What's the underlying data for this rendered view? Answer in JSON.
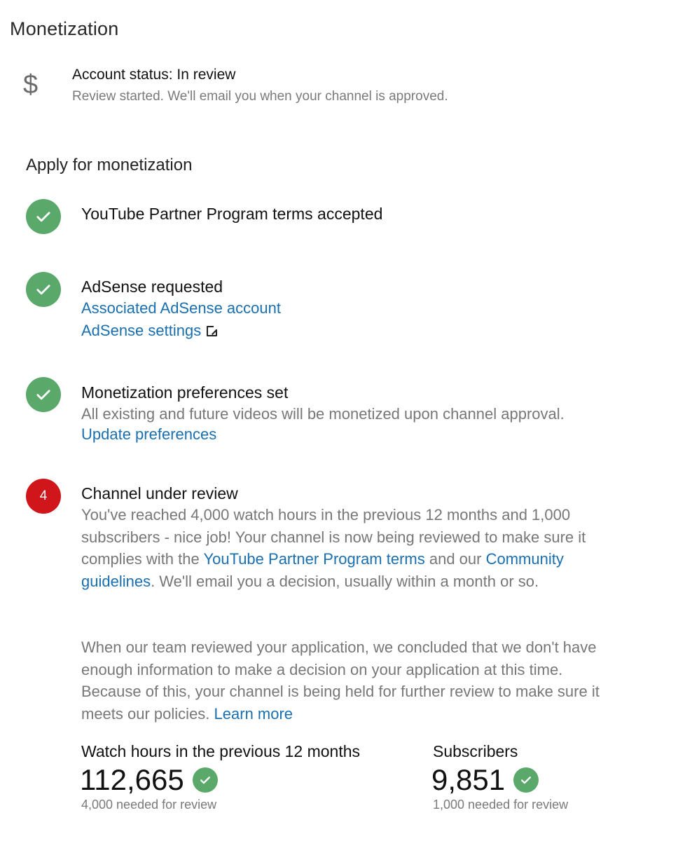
{
  "page": {
    "title": "Monetization"
  },
  "account": {
    "icon": "dollar-icon",
    "icon_glyph": "$",
    "status": "Account status: In review",
    "subtitle": "Review started. We'll email you when your channel is approved."
  },
  "apply": {
    "title": "Apply for monetization",
    "steps": [
      {
        "state": "done",
        "icon": "check-circle-icon",
        "title": "YouTube Partner Program terms accepted"
      },
      {
        "state": "done",
        "icon": "check-circle-icon",
        "title": "AdSense requested",
        "links": [
          "Associated AdSense account",
          "AdSense settings"
        ]
      },
      {
        "state": "done",
        "icon": "check-circle-icon",
        "title": "Monetization preferences set",
        "text": "All existing and future videos will be monetized upon channel approval.",
        "link": "Update preferences"
      },
      {
        "state": "in-review",
        "number": "4",
        "title": "Channel under review",
        "para1_a": "You've reached 4,000 watch hours in the previous 12 months and 1,000 subscribers - nice job! Your channel is now being reviewed to make sure it complies with the ",
        "para1_link1": "YouTube Partner Program terms",
        "para1_b": " and our ",
        "para1_link2": "Community guidelines",
        "para1_c": ". We'll email you a decision, usually within a month or so.",
        "para2": "When our team reviewed your application, we concluded that we don't have enough information to make a decision on your application at this time. Because of this, your channel is being held for further review to make sure it meets our policies. ",
        "para2_link": "Learn more"
      }
    ]
  },
  "metrics": {
    "watch_hours": {
      "label": "Watch hours in the previous 12 months",
      "value": "112,665",
      "note": "4,000 needed for review"
    },
    "subscribers": {
      "label": "Subscribers",
      "value": "9,851",
      "note": "1,000 needed for review"
    }
  },
  "colors": {
    "check_green": "#5aa86a",
    "alert_red": "#d0151b",
    "link_blue": "#1a6fb0"
  }
}
